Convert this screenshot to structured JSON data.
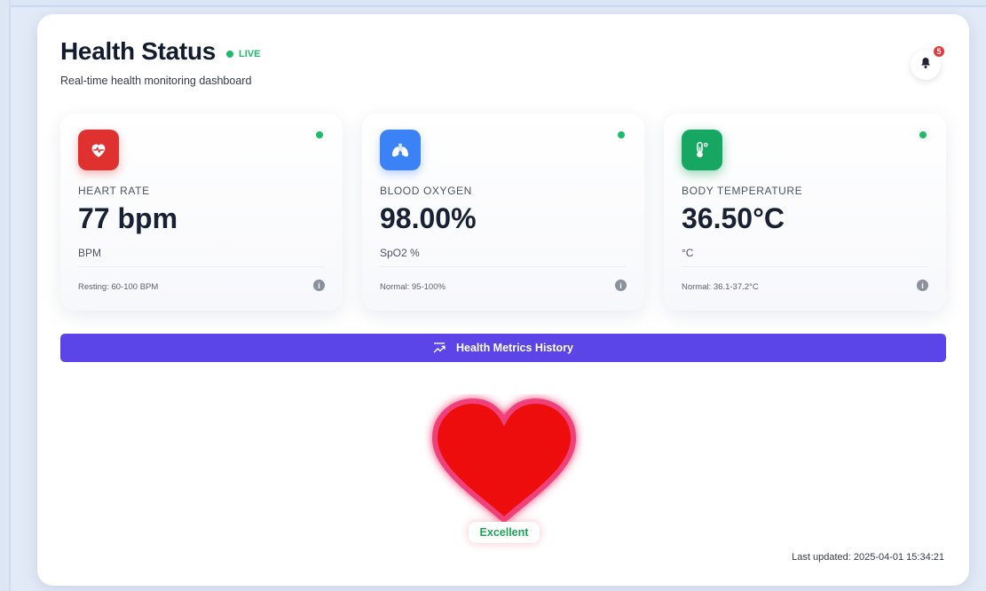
{
  "header": {
    "title": "Health Status",
    "live_label": "LIVE",
    "subtitle": "Real-time health monitoring dashboard",
    "notification_count": "5"
  },
  "metrics": [
    {
      "label": "HEART RATE",
      "value": "77 bpm",
      "unit": "BPM",
      "range": "Resting: 60-100 BPM",
      "icon": "heart-pulse-icon",
      "color": "#e03131"
    },
    {
      "label": "BLOOD OXYGEN",
      "value": "98.00%",
      "unit": "SpO2 %",
      "range": "Normal: 95-100%",
      "icon": "lungs-icon",
      "color": "#3b82f6"
    },
    {
      "label": "BODY TEMPERATURE",
      "value": "36.50°C",
      "unit": "°C",
      "range": "Normal: 36.1-37.2°C",
      "icon": "thermometer-icon",
      "color": "#16a862"
    }
  ],
  "history_button": {
    "label": "Health Metrics History",
    "color": "#5b45e8"
  },
  "status": {
    "label": "Excellent",
    "heart_color": "#ee1010"
  },
  "footer": {
    "last_updated": "Last updated: 2025-04-01 15:34:21"
  }
}
